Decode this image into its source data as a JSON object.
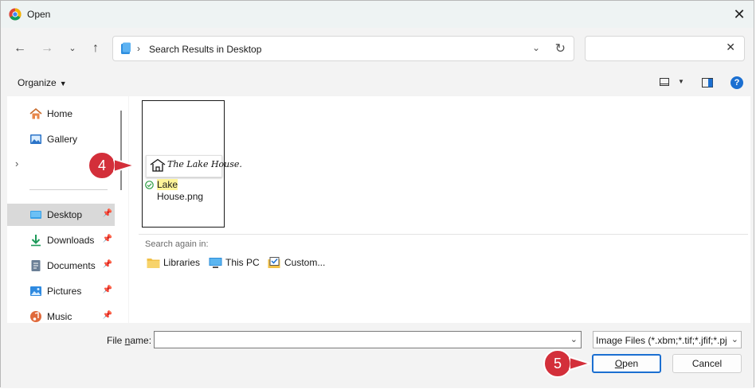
{
  "window": {
    "title": "Open",
    "close_symbol": "✕"
  },
  "nav": {
    "address_path": "Search Results in Desktop",
    "search_value": ""
  },
  "command_bar": {
    "organize_label": "Organize"
  },
  "sidebar": {
    "items": [
      {
        "label": "Home",
        "icon": "home-icon"
      },
      {
        "label": "Gallery",
        "icon": "gallery-icon"
      },
      {
        "label": "Desktop",
        "icon": "desktop-icon",
        "selected": true,
        "pinned": true
      },
      {
        "label": "Downloads",
        "icon": "downloads-icon",
        "pinned": true
      },
      {
        "label": "Documents",
        "icon": "documents-icon",
        "pinned": true
      },
      {
        "label": "Pictures",
        "icon": "pictures-icon",
        "pinned": true
      },
      {
        "label": "Music",
        "icon": "music-icon",
        "pinned": true
      }
    ]
  },
  "content": {
    "file": {
      "name_highlight": "Lake",
      "name_rest": "House.png",
      "thumbnail_text": "The Lake House."
    },
    "search_again": {
      "label": "Search again in:",
      "locations": [
        "Libraries",
        "This PC",
        "Custom..."
      ]
    }
  },
  "footer": {
    "file_name_label_pre": "File ",
    "file_name_label_accel": "n",
    "file_name_label_post": "ame:",
    "file_name_value": "",
    "file_type": "Image Files (*.xbm;*.tif;*.jfif;*.pjp",
    "open_label_accel": "O",
    "open_label_rest": "pen",
    "cancel_label": "Cancel"
  },
  "callouts": [
    "4",
    "5"
  ],
  "colors": {
    "accent": "#1b6fd1",
    "callout": "#d32f3a",
    "highlight": "#fff59a"
  }
}
